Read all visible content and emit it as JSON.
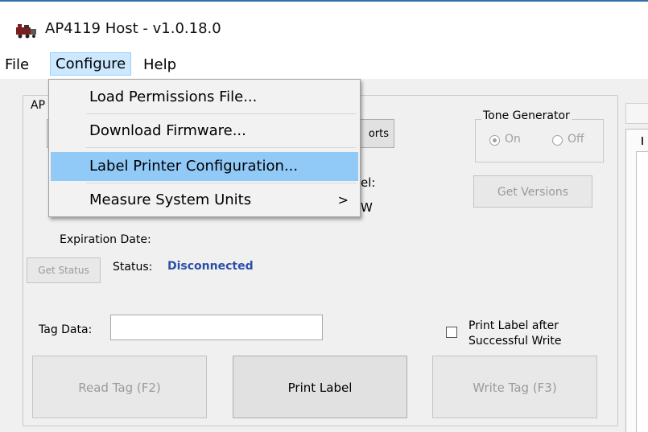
{
  "window": {
    "title": "AP4119 Host - v1.0.18.0",
    "accent_color": "#2f6ea7"
  },
  "menubar": {
    "file": "File",
    "configure": "Configure",
    "help": "Help"
  },
  "dropdown": {
    "items": [
      {
        "label": "Load Permissions File..."
      },
      {
        "label": "Download Firmware..."
      },
      {
        "label": "Label Printer Configuration...",
        "highlighted": true
      },
      {
        "label": "Measure System Units",
        "submenu_arrow": ">"
      }
    ]
  },
  "group": {
    "legend": "AP",
    "ports_button": "orts",
    "model_label": "el:",
    "fw_label": "W"
  },
  "tone_generator": {
    "legend": "Tone Generator",
    "on_label": "On",
    "off_label": "Off",
    "selected": "On"
  },
  "get_versions_button": "Get Versions",
  "expiration": {
    "label": "Expiration Date:"
  },
  "status": {
    "button": "Get Status",
    "label": "Status:",
    "value": "Disconnected",
    "value_color": "#2a4fa8"
  },
  "tag_data": {
    "label": "Tag Data:",
    "value": ""
  },
  "print_after": {
    "line1": "Print Label after",
    "line2": "Successful Write",
    "checked": false
  },
  "buttons": {
    "read_tag": "Read Tag (F2)",
    "print_label": "Print Label",
    "write_tag": "Write Tag (F3)"
  }
}
